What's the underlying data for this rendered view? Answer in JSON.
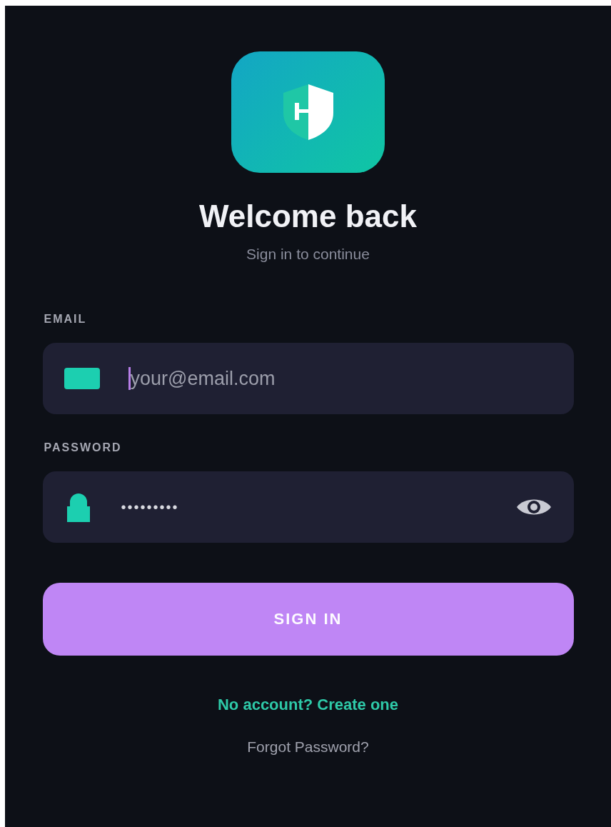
{
  "title": "Welcome back",
  "subtitle": "Sign in to continue",
  "fields": [
    {
      "kind": "email",
      "label": "EMAIL",
      "placeholder": "your@email.com",
      "focused": true
    },
    {
      "kind": "password",
      "label": "PASSWORD",
      "value": "•••••••••",
      "focused": false
    }
  ],
  "primary_button": "SIGN IN",
  "signup_link": "No account? Create one",
  "forgot_link": "Forgot Password?"
}
